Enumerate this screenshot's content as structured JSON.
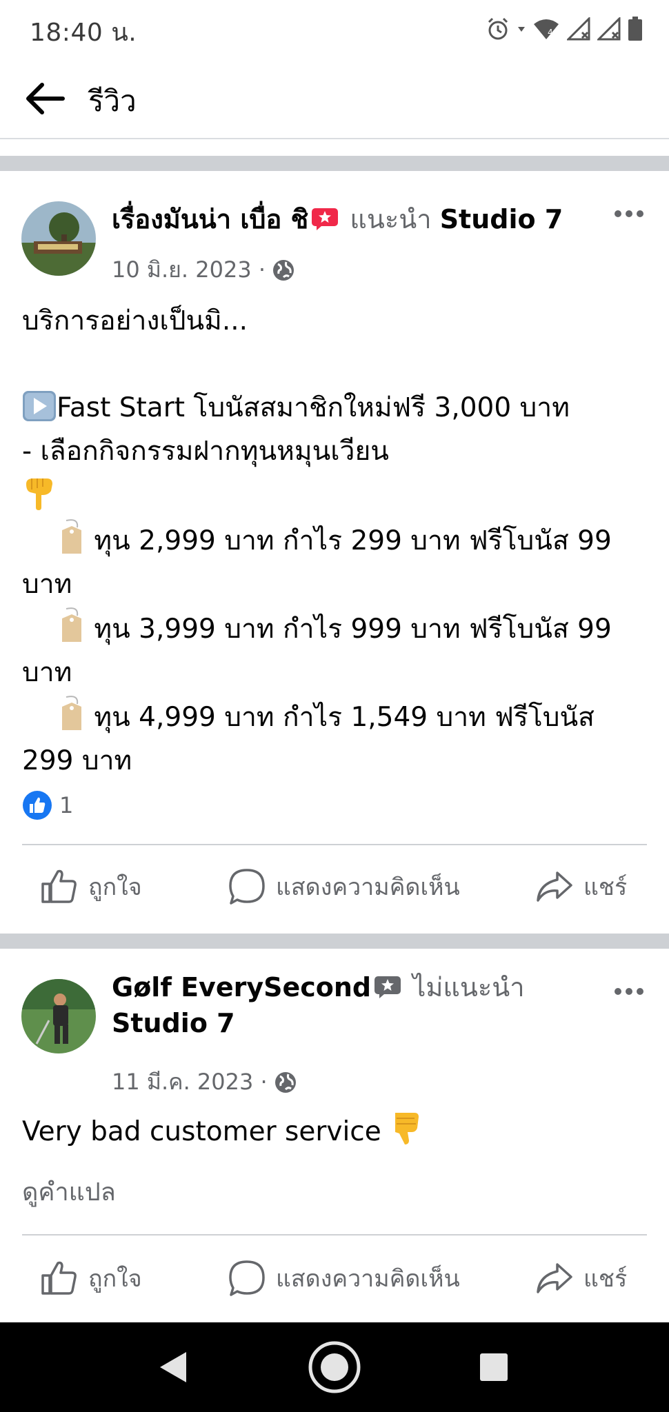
{
  "status_bar": {
    "time": "18:40 น."
  },
  "header": {
    "title": "รีวิว"
  },
  "posts": [
    {
      "author": "เรื่องมันน่า เบื่อ ชิ",
      "recommendation_text": "แนะนำ",
      "page_name": "Studio 7",
      "badge_color": "#f02849",
      "date": "10 มิ.ย. 2023 ·",
      "body_lines": [
        "บริการอย่างเป็นมิ...",
        "",
        "Fast Start โบนัสสมาชิกใหม่ฟรี 3,000 บาท",
        "- เลือกกิจกรรมฝากทุนหมุนเวียน",
        "",
        "ทุน 2,999 บาท กำไร 299 บาท ฟรีโบนัส 99 บาท",
        "ทุน 3,999 บาท กำไร 999 บาท ฟรีโบนัส 99 บาท",
        "ทุน 4,999 บาท กำไร 1,549 บาท ฟรีโบนัส 299 บาท"
      ],
      "like_count": "1",
      "actions": {
        "like": "ถูกใจ",
        "comment": "แสดงความคิดเห็น",
        "share": "แชร์"
      }
    },
    {
      "author": "Gølf EverySecond",
      "recommendation_text": "ไม่แนะนำ",
      "page_name": "Studio 7",
      "badge_color": "#65676b",
      "date": "11 มี.ค. 2023 ·",
      "body_lines": [
        "Very bad customer service"
      ],
      "see_translation": "ดูคำแปล",
      "actions": {
        "like": "ถูกใจ",
        "comment": "แสดงความคิดเห็น",
        "share": "แชร์"
      }
    }
  ],
  "colors": {
    "text_primary": "#050505",
    "text_secondary": "#65676b",
    "separator": "#cdd0d4",
    "like_blue": "#1877f2"
  }
}
